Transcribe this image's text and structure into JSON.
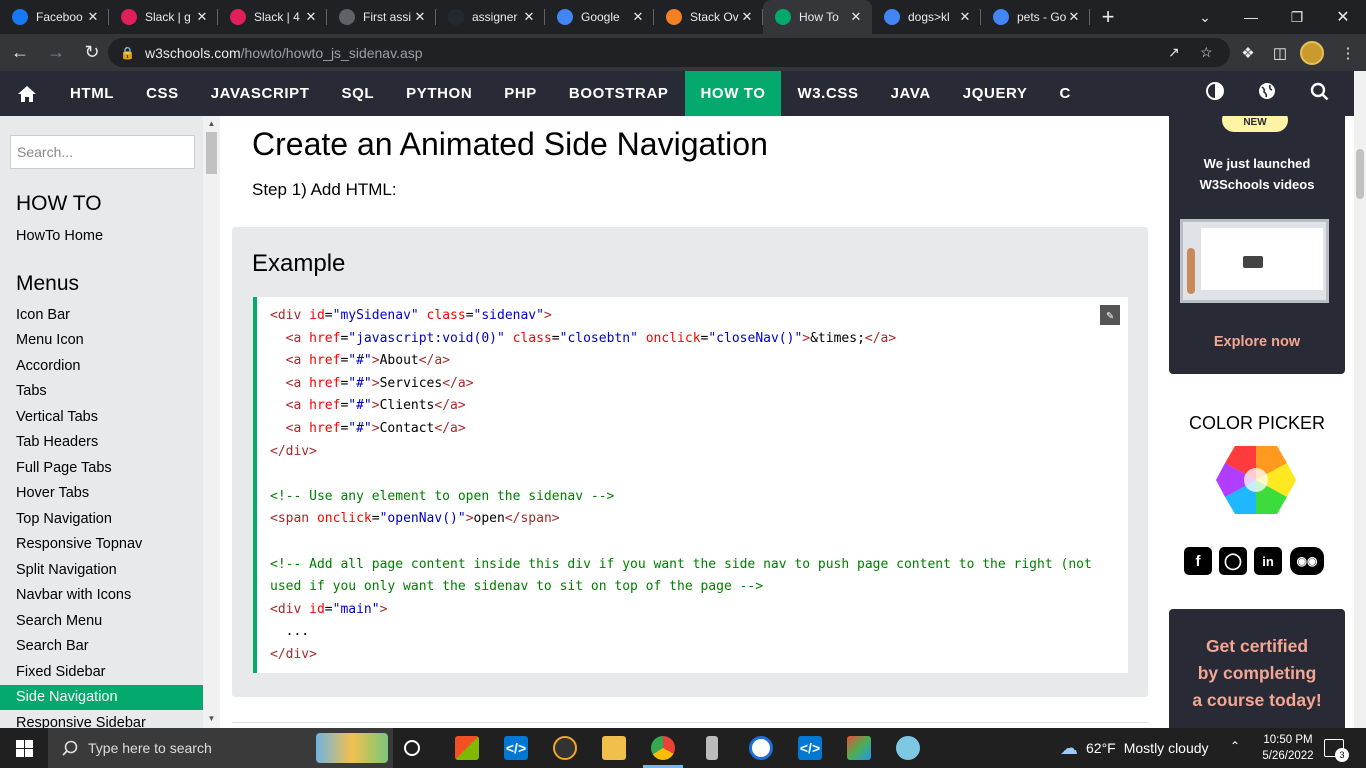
{
  "browser": {
    "tabs": [
      {
        "title": "Faceboo",
        "icon": "facebook-icon",
        "color": "#1877f2"
      },
      {
        "title": "Slack | g",
        "icon": "slack-icon",
        "color": "#e01e5a"
      },
      {
        "title": "Slack | 4",
        "icon": "slack-icon",
        "color": "#e01e5a"
      },
      {
        "title": "First assi",
        "icon": "globe-icon",
        "color": "#5f6368"
      },
      {
        "title": "assigner",
        "icon": "github-icon",
        "color": "#24292f"
      },
      {
        "title": "Google",
        "icon": "google-icon",
        "color": "#4285f4"
      },
      {
        "title": "Stack Ov",
        "icon": "stackoverflow-icon",
        "color": "#f48024"
      },
      {
        "title": "How To",
        "icon": "w3schools-icon",
        "color": "#04aa6d"
      },
      {
        "title": "dogs>kl",
        "icon": "google-icon",
        "color": "#4285f4"
      },
      {
        "title": "pets - Go",
        "icon": "google-icon",
        "color": "#4285f4"
      }
    ],
    "url_domain": "w3schools.com",
    "url_path": "/howto/howto_js_sidenav.asp"
  },
  "topnav": {
    "items": [
      "HTML",
      "CSS",
      "JAVASCRIPT",
      "SQL",
      "PYTHON",
      "PHP",
      "BOOTSTRAP",
      "HOW TO",
      "W3.CSS",
      "JAVA",
      "JQUERY",
      "C"
    ],
    "active": "HOW TO"
  },
  "sidebar": {
    "search_placeholder": "Search...",
    "section1": "HOW TO",
    "section1_items": [
      "HowTo Home"
    ],
    "section2": "Menus",
    "section2_items": [
      "Icon Bar",
      "Menu Icon",
      "Accordion",
      "Tabs",
      "Vertical Tabs",
      "Tab Headers",
      "Full Page Tabs",
      "Hover Tabs",
      "Top Navigation",
      "Responsive Topnav",
      "Split Navigation",
      "Navbar with Icons",
      "Search Menu",
      "Search Bar",
      "Fixed Sidebar",
      "Side Navigation",
      "Responsive Sidebar"
    ],
    "active_item": "Side Navigation"
  },
  "main": {
    "title": "Create an Animated Side Navigation",
    "step": "Step 1) Add HTML:",
    "example_heading": "Example",
    "code_lines": [
      "<div id=\"mySidenav\" class=\"sidenav\">",
      "  <a href=\"javascript:void(0)\" class=\"closebtn\" onclick=\"closeNav()\">&times;</a>",
      "  <a href=\"#\">About</a>",
      "  <a href=\"#\">Services</a>",
      "  <a href=\"#\">Clients</a>",
      "  <a href=\"#\">Contact</a>",
      "</div>",
      "",
      "<!-- Use any element to open the sidenav -->",
      "<span onclick=\"openNav()\">open</span>",
      "",
      "<!-- Add all page content inside this div if you want the side nav to push page content to the right (not",
      "used if you only want the sidenav to sit on top of the page -->",
      "<div id=\"main\">",
      "  ...",
      "</div>"
    ]
  },
  "right": {
    "badge": "NEW",
    "promo_line1": "We just launched",
    "promo_line2": "W3Schools videos",
    "explore": "Explore now",
    "color_picker": "COLOR PICKER",
    "cert_line1": "Get certified",
    "cert_line2": "by completing",
    "cert_line3": "a course today!"
  },
  "taskbar": {
    "search_placeholder": "Type here to search",
    "temperature": "62°F",
    "weather": "Mostly cloudy",
    "time": "10:50 PM",
    "date": "5/26/2022",
    "notifications": "3"
  }
}
